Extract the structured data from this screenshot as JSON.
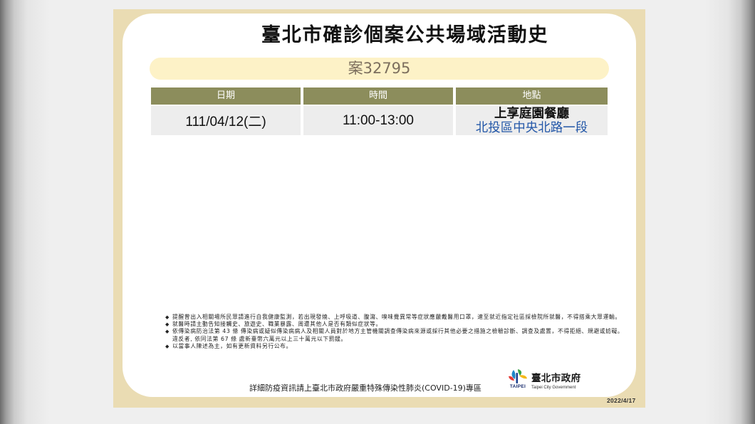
{
  "slide": {
    "title": "臺北市確診個案公共場域活動史",
    "case_label": "案32795",
    "table": {
      "headers": {
        "date": "日期",
        "time": "時間",
        "place": "地點"
      },
      "rows": [
        {
          "date": "111/04/12(二)",
          "time": "11:00-13:00",
          "place_name": "上享庭園餐廳",
          "place_address": "北投區中央北路一段"
        }
      ]
    },
    "notes": [
      {
        "bullet": "◆",
        "lines": [
          "提醒曾出入相關場所民眾請進行自我健康監測，若出現發燒、上呼吸道、腹瀉、嗅味覺異常等症狀應嚴戴醫用口罩，速至就近指定社區採檢院所就醫，不得搭乘大眾運輸。"
        ]
      },
      {
        "bullet": "◆",
        "lines": [
          "就醫時請主動告知接觸史、旅遊史、職業暴露、周遭其他人是否有類似症狀等。"
        ]
      },
      {
        "bullet": "◆",
        "lines": [
          "依傳染病防治法第 43 條 傳染病或疑似傳染病病人及相關人員對於地方主管機關調查傳染病來源或採行其他必要之措施之檢驗診斷、調查及處置，不得拒絕、規避或妨礙。",
          "違反者, 依同法第 67 條 處新臺幣六萬元以上三十萬元以下罰鍰。"
        ]
      },
      {
        "bullet": "◆",
        "lines": [
          "以當事人陳述為主，如有更新資料另行公布。"
        ]
      }
    ],
    "footer_text": "詳細防疫資訊請上臺北市政府嚴重特殊傳染性肺炎(COVID-19)專區",
    "logo": {
      "icon": "taipei-city-logo-icon",
      "mark_text": "TAIPEI",
      "name": "臺北市政府",
      "english_name": "Taipei City Government"
    },
    "date": "2022/4/17"
  },
  "colors": {
    "frame": "#eadcb3",
    "header_bg": "#8c8d5c",
    "header_text": "#ffffff",
    "case_bar_bg": "#fdf2c7",
    "case_label": "#7c6f5e",
    "row_bg": "#ededed",
    "address": "#2357a8"
  }
}
